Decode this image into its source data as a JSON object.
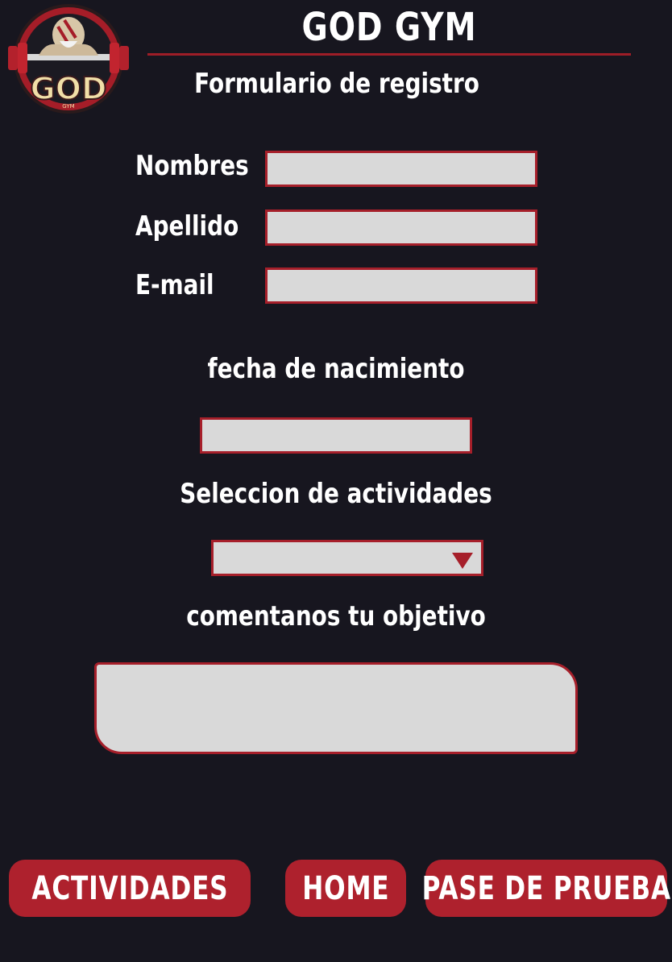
{
  "header": {
    "title": "GOD GYM",
    "subtitle": "Formulario de registro",
    "logo": {
      "text": "GOD",
      "subtext": "GYM"
    }
  },
  "form": {
    "nombres": {
      "label": "Nombres",
      "value": ""
    },
    "apellido": {
      "label": "Apellido",
      "value": ""
    },
    "email": {
      "label": "E-mail",
      "value": ""
    },
    "fecha": {
      "label": "fecha de nacimiento",
      "value": ""
    },
    "actividades": {
      "label": "Seleccion de actividades",
      "value": ""
    },
    "objetivo": {
      "label": "comentanos tu objetivo",
      "value": ""
    }
  },
  "nav": {
    "actividades": "ACTIVIDADES",
    "home": "HOME",
    "pase": "PASE DE PRUEBA"
  },
  "colors": {
    "background": "#17161f",
    "accent": "#ae212d",
    "field": "#d9d9d9"
  }
}
